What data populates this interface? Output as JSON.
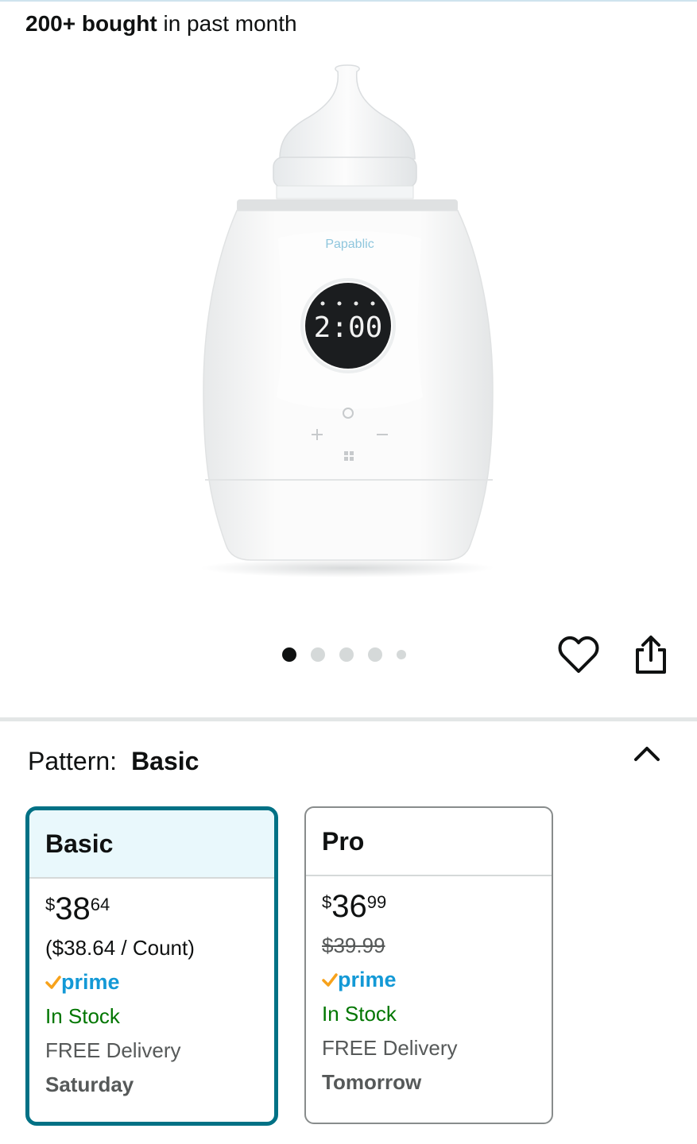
{
  "header": {
    "bought_bold": "200+ bought",
    "bought_rest": " in past month"
  },
  "product_image": {
    "brand_text": "Papablic",
    "display_time": "2:00"
  },
  "carousel": {
    "total": 5,
    "active": 0
  },
  "pattern": {
    "label": "Pattern:",
    "value": "Basic"
  },
  "options": [
    {
      "name": "Basic",
      "price_symbol": "$",
      "price_whole": "38",
      "price_fraction": "64",
      "unit_price": "($38.64 / Count)",
      "prime": "prime",
      "stock": "In Stock",
      "delivery": "FREE Delivery",
      "day": "Saturday",
      "selected": true
    },
    {
      "name": "Pro",
      "price_symbol": "$",
      "price_whole": "36",
      "price_fraction": "99",
      "list_price": "$39.99",
      "prime": "prime",
      "stock": "In Stock",
      "delivery": "FREE Delivery",
      "day": "Tomorrow",
      "selected": false
    }
  ],
  "colors": {
    "accent": "#007185",
    "selected_bg": "#e9f8fc",
    "stock": "#007600",
    "prime_blue": "#1399d6",
    "prime_check": "#f7a21b"
  },
  "icons": [
    "heart-icon",
    "share-icon",
    "chevron-up-icon",
    "prime-check-icon"
  ]
}
